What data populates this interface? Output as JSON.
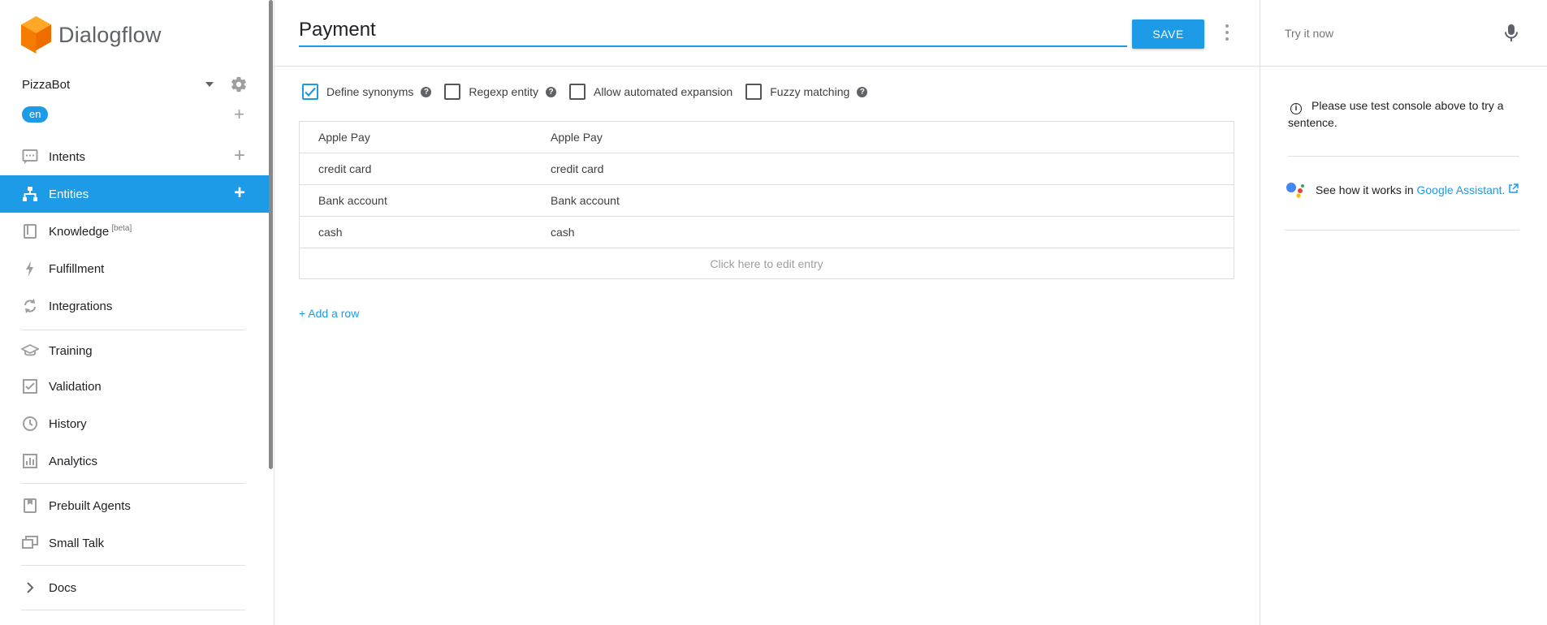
{
  "brand": {
    "name": "Dialogflow"
  },
  "agent": {
    "name": "PizzaBot",
    "language": "en"
  },
  "nav": {
    "intents": "Intents",
    "entities": "Entities",
    "knowledge": "Knowledge",
    "knowledge_badge": "[beta]",
    "fulfillment": "Fulfillment",
    "integrations": "Integrations",
    "training": "Training",
    "validation": "Validation",
    "history": "History",
    "analytics": "Analytics",
    "prebuilt_agents": "Prebuilt Agents",
    "small_talk": "Small Talk",
    "docs": "Docs"
  },
  "editor": {
    "entity_name": "Payment",
    "save_label": "SAVE",
    "options": {
      "define_synonyms": {
        "label": "Define synonyms",
        "checked": true
      },
      "regexp_entity": {
        "label": "Regexp entity",
        "checked": false
      },
      "allow_expansion": {
        "label": "Allow automated expansion",
        "checked": false
      },
      "fuzzy_matching": {
        "label": "Fuzzy matching",
        "checked": false
      }
    },
    "rows": [
      {
        "value": "Apple Pay",
        "synonyms": "Apple Pay"
      },
      {
        "value": "credit card",
        "synonyms": "credit card"
      },
      {
        "value": "Bank account",
        "synonyms": "Bank account"
      },
      {
        "value": "cash",
        "synonyms": "cash"
      }
    ],
    "edit_entry_hint": "Click here to edit entry",
    "add_row": "+ Add a row"
  },
  "console": {
    "placeholder": "Try it now",
    "info_text": "Please use test console above to try a sentence.",
    "ga_prefix": "See how it works in",
    "ga_link": "Google Assistant."
  },
  "colors": {
    "accent": "#1e9be6",
    "logo_orange": "#ef6c00"
  }
}
